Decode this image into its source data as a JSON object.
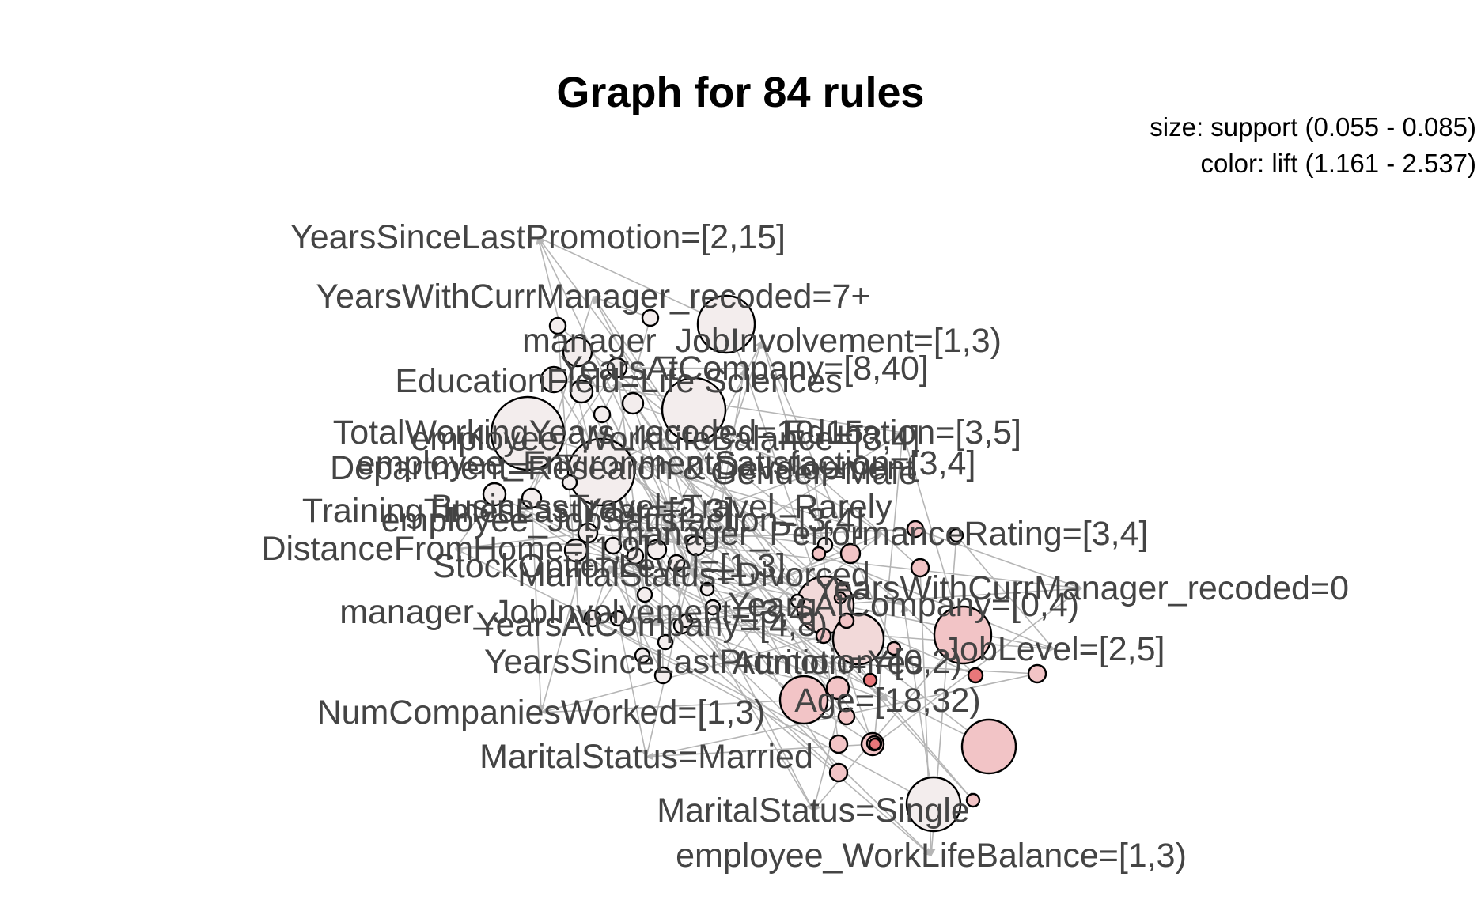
{
  "chart_data": {
    "type": "graph",
    "title": "Graph for 84 rules",
    "legend": {
      "size": "size: support (0.055 - 0.085)",
      "color": "color: lift (1.161 - 2.537)",
      "placement": "top-right"
    },
    "support_range": [
      0.055,
      0.085
    ],
    "lift_range": [
      1.161,
      2.537
    ],
    "colors": {
      "edge": "#b5b5b5",
      "node_low_lift": "#f3eded",
      "node_high_lift": "#e8777a",
      "label": "#444444"
    },
    "item_labels": [
      "YearsSinceLastPromotion=[2,15]",
      "YearsWithCurrManager_recoded=7+",
      "manager_JobInvolvement=[1,3)",
      "YearsAtCompany=[8,40]",
      "EducationField=Life Sciences",
      "Education=[3,5]",
      "TotalWorkingYears_recoded=10-15",
      "employee_WorkLifeBalance=[3,4]",
      "employee_EnvironmentSatisfaction=[3,4]",
      "Department=Research & Development",
      "Gender=Male",
      "BusinessTravel=Travel_Rarely",
      "TrainingTimesLastYear=[2,3]",
      "employee_JobSatisfaction=[3,4]",
      "manager_PerformanceRating=[3,4]",
      "DistanceFromHome=[1,9]",
      "StockOptionLevel=[1,3]",
      "MaritalStatus=Divorced",
      "YearsWithCurrManager_recoded=0",
      "manager_JobInvolvement=[3,4]",
      "YearsAtCompany=[0,4)",
      "YearsAtCompany=[4,8)",
      "JobLevel=[2,5]",
      "YearsSinceLastPromotion=[0,2)",
      "Attrition=Yes",
      "Age=[18,32)",
      "NumCompaniesWorked=[1,3)",
      "MaritalStatus=Married",
      "MaritalStatus=Single",
      "employee_WorkLifeBalance=[1,3)"
    ]
  }
}
